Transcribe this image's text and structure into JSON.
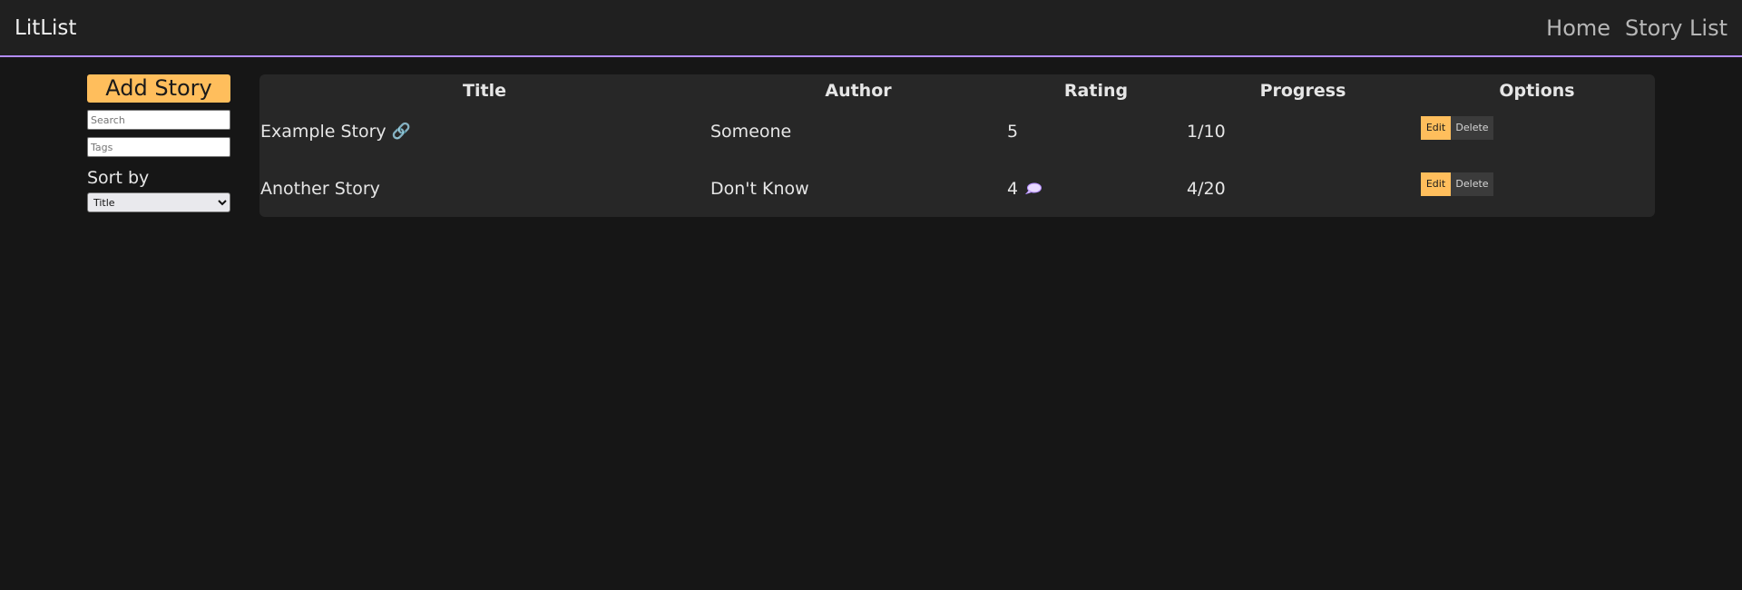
{
  "header": {
    "brand": "LitList",
    "nav": [
      "Home",
      "Story List"
    ]
  },
  "sidebar": {
    "add_story_label": "Add Story",
    "search_placeholder": "Search",
    "tags_placeholder": "Tags",
    "sort_label": "Sort by",
    "sort_selected": "Title"
  },
  "table": {
    "columns": [
      "Title",
      "Author",
      "Rating",
      "Progress",
      "Options"
    ],
    "rows": [
      {
        "title": "Example Story",
        "author": "Someone",
        "rating": "5",
        "progress": "1/10",
        "has_link": true,
        "has_comment": false,
        "edit_label": "Edit",
        "delete_label": "Delete"
      },
      {
        "title": "Another Story",
        "author": "Don't Know",
        "rating": "4",
        "progress": "4/20",
        "has_link": false,
        "has_comment": true,
        "edit_label": "Edit",
        "delete_label": "Delete"
      }
    ]
  },
  "icons": {
    "link": "link-icon",
    "comment": "comment-icon"
  },
  "colors": {
    "accent": "#ffbe5c",
    "divider": "#b38cff",
    "background": "#161616",
    "panel": "#272727"
  }
}
